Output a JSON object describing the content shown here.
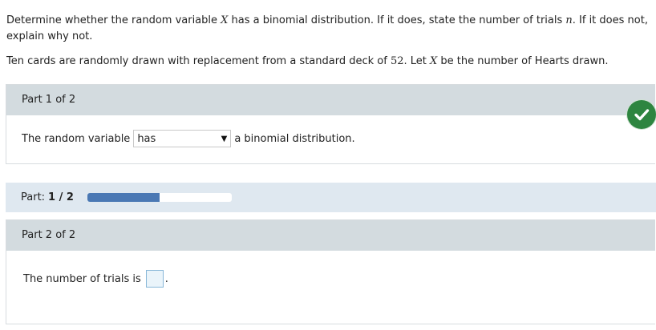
{
  "question": {
    "line1_a": "Determine whether the random variable ",
    "var_x": "X",
    "line1_b": " has a binomial distribution. If it does, state the number of trials ",
    "var_n": "n",
    "line1_c": ". If it does not, explain why not.",
    "line2_a": "Ten cards are randomly drawn with replacement from a standard deck of ",
    "deck_size": "52",
    "line2_b": ". Let ",
    "line2_c": " be the number of Hearts drawn."
  },
  "part1": {
    "title": "Part 1 of 2",
    "prefix": "The random variable",
    "selected": "has",
    "suffix": "a binomial distribution.",
    "status_icon": "checkmark-icon",
    "status_color": "#2e8540"
  },
  "progress": {
    "label": "Part:",
    "value": "1 / 2",
    "fraction": 0.5,
    "fill_color": "#4a78b4"
  },
  "part2": {
    "title": "Part 2 of 2",
    "prefix": "The number of trials is",
    "suffix": ".",
    "input_value": ""
  }
}
